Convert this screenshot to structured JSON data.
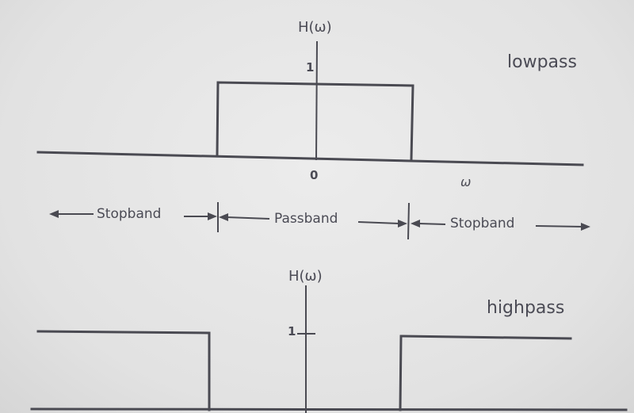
{
  "lowpass": {
    "title": "lowpass",
    "axis_label": "H(ω)",
    "unity_tick": "1",
    "origin_label": "0",
    "omega_label": "ω"
  },
  "bands": {
    "left": "Stopband",
    "middle": "Passband",
    "right": "Stopband"
  },
  "highpass": {
    "title": "highpass",
    "axis_label": "H(ω)",
    "unity_tick": "1"
  }
}
